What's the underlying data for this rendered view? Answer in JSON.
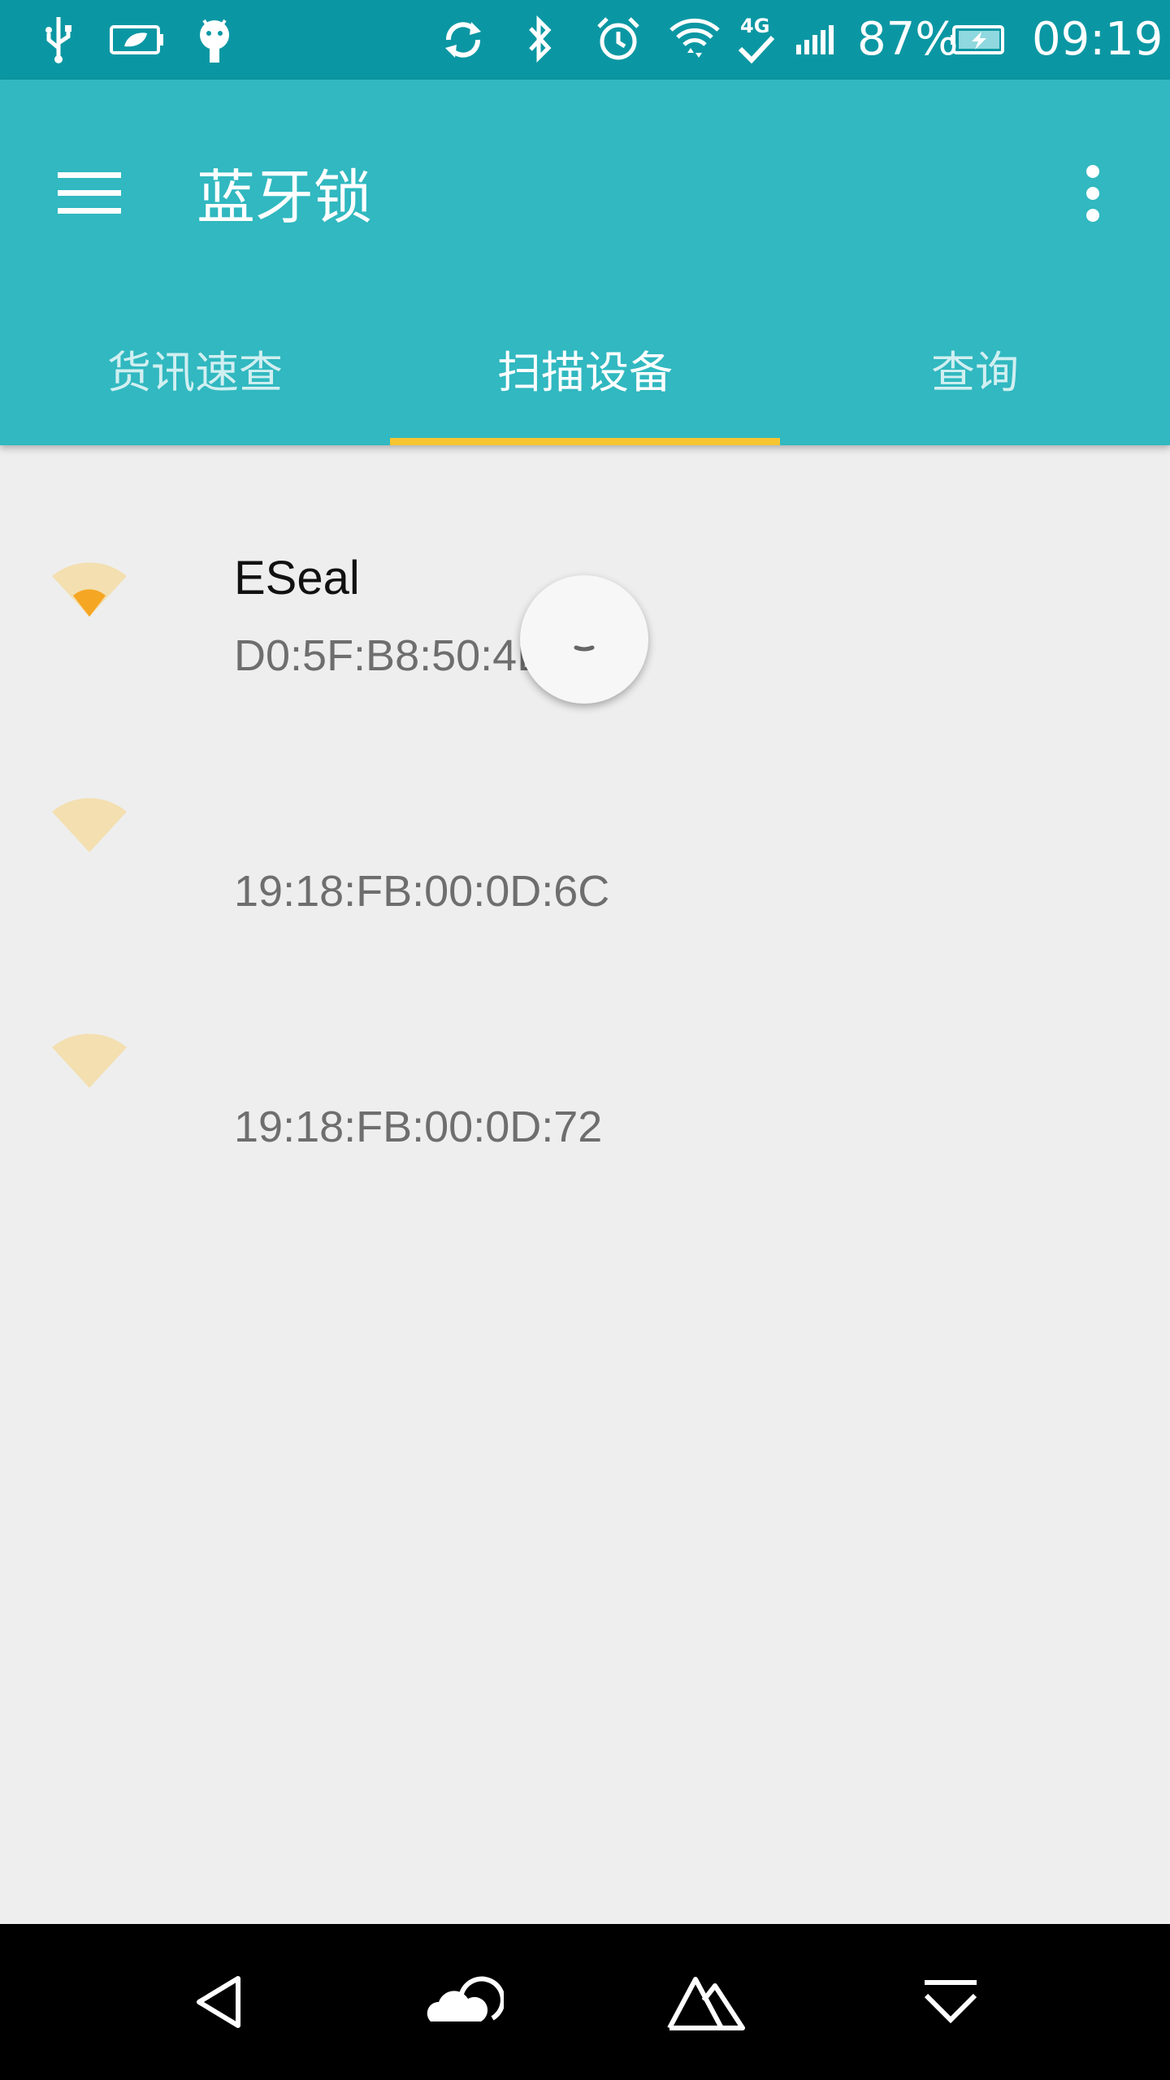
{
  "status_bar": {
    "battery_percent": "87%",
    "time": "09:19",
    "network": "4G",
    "icons": [
      "usb-icon",
      "battery-saver-icon",
      "android-icon",
      "sync-icon",
      "bluetooth-icon",
      "alarm-icon",
      "wifi-icon",
      "network-4g-icon",
      "signal-icon",
      "battery-charging-icon"
    ]
  },
  "app_bar": {
    "title": "蓝牙锁",
    "menu_icon": "hamburger-menu-icon",
    "more_icon": "more-vert-icon",
    "tabs": [
      {
        "label": "货讯速查",
        "active": false
      },
      {
        "label": "扫描设备",
        "active": true
      },
      {
        "label": "查询",
        "active": false
      }
    ],
    "accent": "#f7c531",
    "background": "#31b8c0",
    "status_bar_background": "#0a97a3"
  },
  "devices": [
    {
      "name": "ESeal",
      "mac": "D0:5F:B8:50:4D",
      "signal_icon": "wifi-signal-weak-icon"
    },
    {
      "name": "",
      "mac": "19:18:FB:00:0D:6C",
      "signal_icon": "wifi-signal-none-icon"
    },
    {
      "name": "",
      "mac": "19:18:FB:00:0D:72",
      "signal_icon": "wifi-signal-none-icon"
    }
  ],
  "nav_bar": {
    "icons": [
      "back-icon",
      "cloud-icon",
      "mountain-icon",
      "dropdown-icon"
    ]
  }
}
